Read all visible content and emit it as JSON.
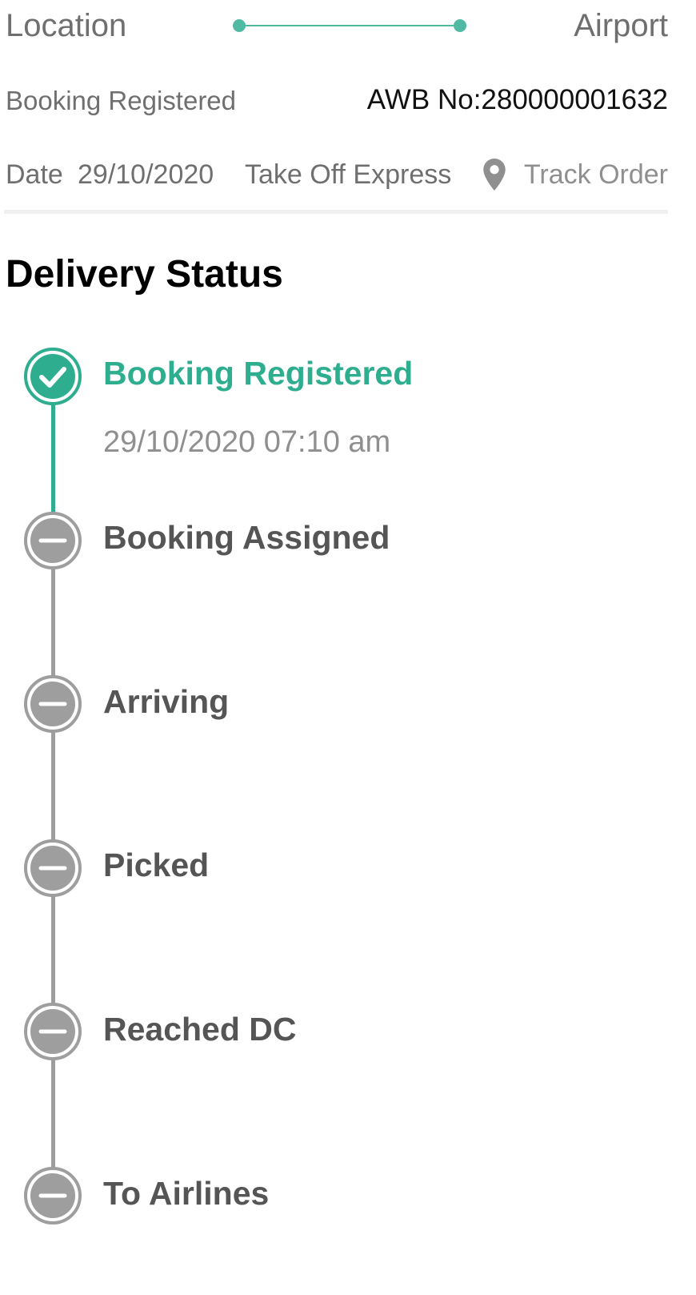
{
  "route": {
    "from": "Location",
    "to": "Airport"
  },
  "order": {
    "status": "Booking Registered",
    "awb": "AWB No:280000001632",
    "date_label": "Date",
    "date_value": "29/10/2020",
    "service": "Take Off Express",
    "track_label": "Track Order",
    "track_icon": "location-pin-icon"
  },
  "section_title": "Delivery Status",
  "colors": {
    "accent": "#2fae8f",
    "pending": "#9e9e9e"
  },
  "timeline": [
    {
      "label": "Booking Registered",
      "time": "29/10/2020 07:10 am",
      "state": "done",
      "icon": "check-circle-icon"
    },
    {
      "label": "Booking Assigned",
      "time": "",
      "state": "pending",
      "icon": "minus-circle-icon"
    },
    {
      "label": "Arriving",
      "time": "",
      "state": "pending",
      "icon": "minus-circle-icon"
    },
    {
      "label": "Picked",
      "time": "",
      "state": "pending",
      "icon": "minus-circle-icon"
    },
    {
      "label": "Reached DC",
      "time": "",
      "state": "pending",
      "icon": "minus-circle-icon"
    },
    {
      "label": "To Airlines",
      "time": "",
      "state": "pending",
      "icon": "minus-circle-icon"
    }
  ]
}
